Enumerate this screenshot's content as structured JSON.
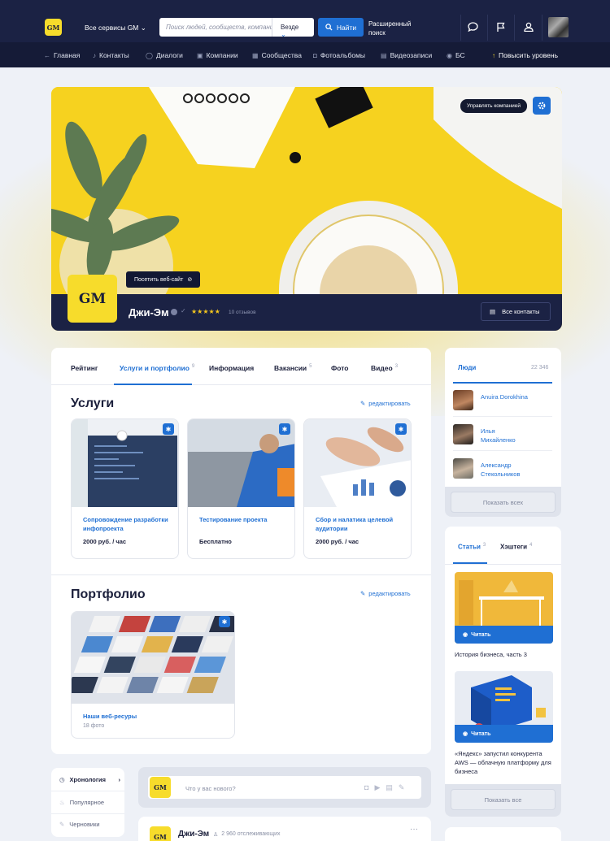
{
  "header": {
    "logo": "GM",
    "services": "Все сервисы GM",
    "search_placeholder": "Поиск людей, сообществ, компани...",
    "scope": "Везде",
    "find": "Найти",
    "advanced": "Расширенный поиск"
  },
  "nav": {
    "items": [
      {
        "label": "Главная",
        "icon": "←"
      },
      {
        "label": "Контакты",
        "icon": "♪"
      },
      {
        "label": "Диалоги",
        "icon": "◯"
      },
      {
        "label": "Компании",
        "icon": "▣"
      },
      {
        "label": "Сообщества",
        "icon": "▦"
      },
      {
        "label": "Фотоальбомы",
        "icon": "◘"
      },
      {
        "label": "Видеозаписи",
        "icon": "▤"
      },
      {
        "label": "БС",
        "icon": "◉"
      }
    ],
    "upgrade": "Повысить уровень"
  },
  "company": {
    "logo": "GM",
    "visit_site": "Посетить веб-сайт",
    "manage": "Управлять компанией",
    "name": "Джи-Эм",
    "stars": "★★★★★",
    "reviews": "10 отзывов",
    "all_contacts": "Все контакты"
  },
  "tabs": [
    {
      "label": "Рейтинг",
      "count": ""
    },
    {
      "label": "Услуги и портфолио",
      "count": "9"
    },
    {
      "label": "Информация",
      "count": ""
    },
    {
      "label": "Вакансии",
      "count": "5"
    },
    {
      "label": "Фото",
      "count": ""
    },
    {
      "label": "Видео",
      "count": "3"
    }
  ],
  "services": {
    "title": "Услуги",
    "edit": "редактировать",
    "items": [
      {
        "title": "Сопровождение разработки инфопроекта",
        "price": "2000 руб. / час"
      },
      {
        "title": "Тестирование проекта",
        "price": "Бесплатно"
      },
      {
        "title": "Сбор и налатика целевой аудитории",
        "price": "2000 руб. / час"
      }
    ]
  },
  "portfolio": {
    "title": "Портфолио",
    "edit": "редактировать",
    "item_title": "Наши веб-ресуры",
    "item_count": "18 фото"
  },
  "people": {
    "title": "Люди",
    "count": "22 346",
    "list": [
      {
        "name": "Anuira Dorokhina"
      },
      {
        "name": "Илья Михайленко"
      },
      {
        "name": "Александр Стекольников"
      }
    ],
    "show_all": "Показать всех"
  },
  "articles": {
    "tab_articles": "Статьи",
    "tab_articles_count": "3",
    "tab_hashtags": "Хэштеги",
    "tab_hashtags_count": "4",
    "read": "Читать",
    "items": [
      {
        "caption": "История бизнеса, часть 3"
      },
      {
        "caption": "«Яндекс» запустил конкурента AWS — облачную платформу для бизнеса"
      }
    ],
    "show_all": "Показать все"
  },
  "feed_menu": {
    "items": [
      "Хронология",
      "Популярное",
      "Черновики"
    ]
  },
  "composer": {
    "logo": "GM",
    "placeholder": "Что у вас нового?"
  },
  "post": {
    "logo": "GM",
    "name": "Джи-Эм",
    "followers": "2 960 отслеживающих",
    "more": "···"
  }
}
